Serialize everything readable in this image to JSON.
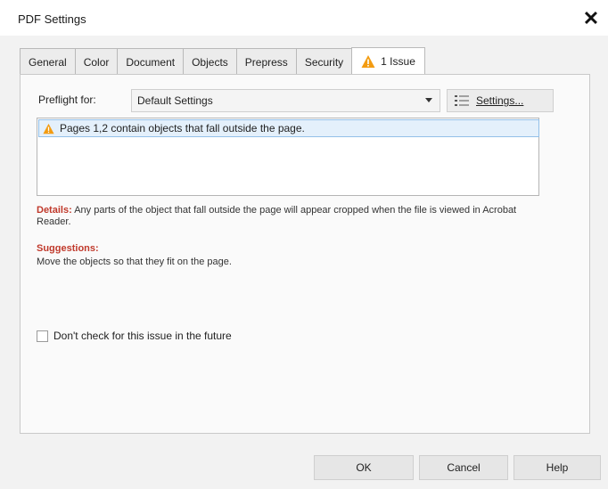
{
  "window": {
    "title": "PDF Settings",
    "close_symbol": "✕"
  },
  "tabs": [
    {
      "label": "General"
    },
    {
      "label": "Color"
    },
    {
      "label": "Document"
    },
    {
      "label": "Objects"
    },
    {
      "label": "Prepress"
    },
    {
      "label": "Security"
    },
    {
      "label": "1 Issue",
      "icon": "warning-icon",
      "active": true
    }
  ],
  "preflight": {
    "label": "Preflight for:",
    "selected": "Default Settings",
    "settings_button": "Settings..."
  },
  "issues": [
    {
      "text": "Pages 1,2 contain objects that fall outside the page.",
      "icon": "warning-icon"
    }
  ],
  "details": {
    "label": "Details:",
    "text": "Any parts of the object that fall outside the page will appear cropped when the file is viewed in Acrobat Reader."
  },
  "suggestions": {
    "label": "Suggestions:",
    "text": "Move the objects so that they fit on the page."
  },
  "checkbox": {
    "label": "Don't check for this issue in the future",
    "checked": false
  },
  "buttons": {
    "ok": "OK",
    "cancel": "Cancel",
    "help": "Help"
  },
  "colors": {
    "warning": "#f39c12",
    "label_red": "#c0392b",
    "selection": "#e4f0fb"
  }
}
